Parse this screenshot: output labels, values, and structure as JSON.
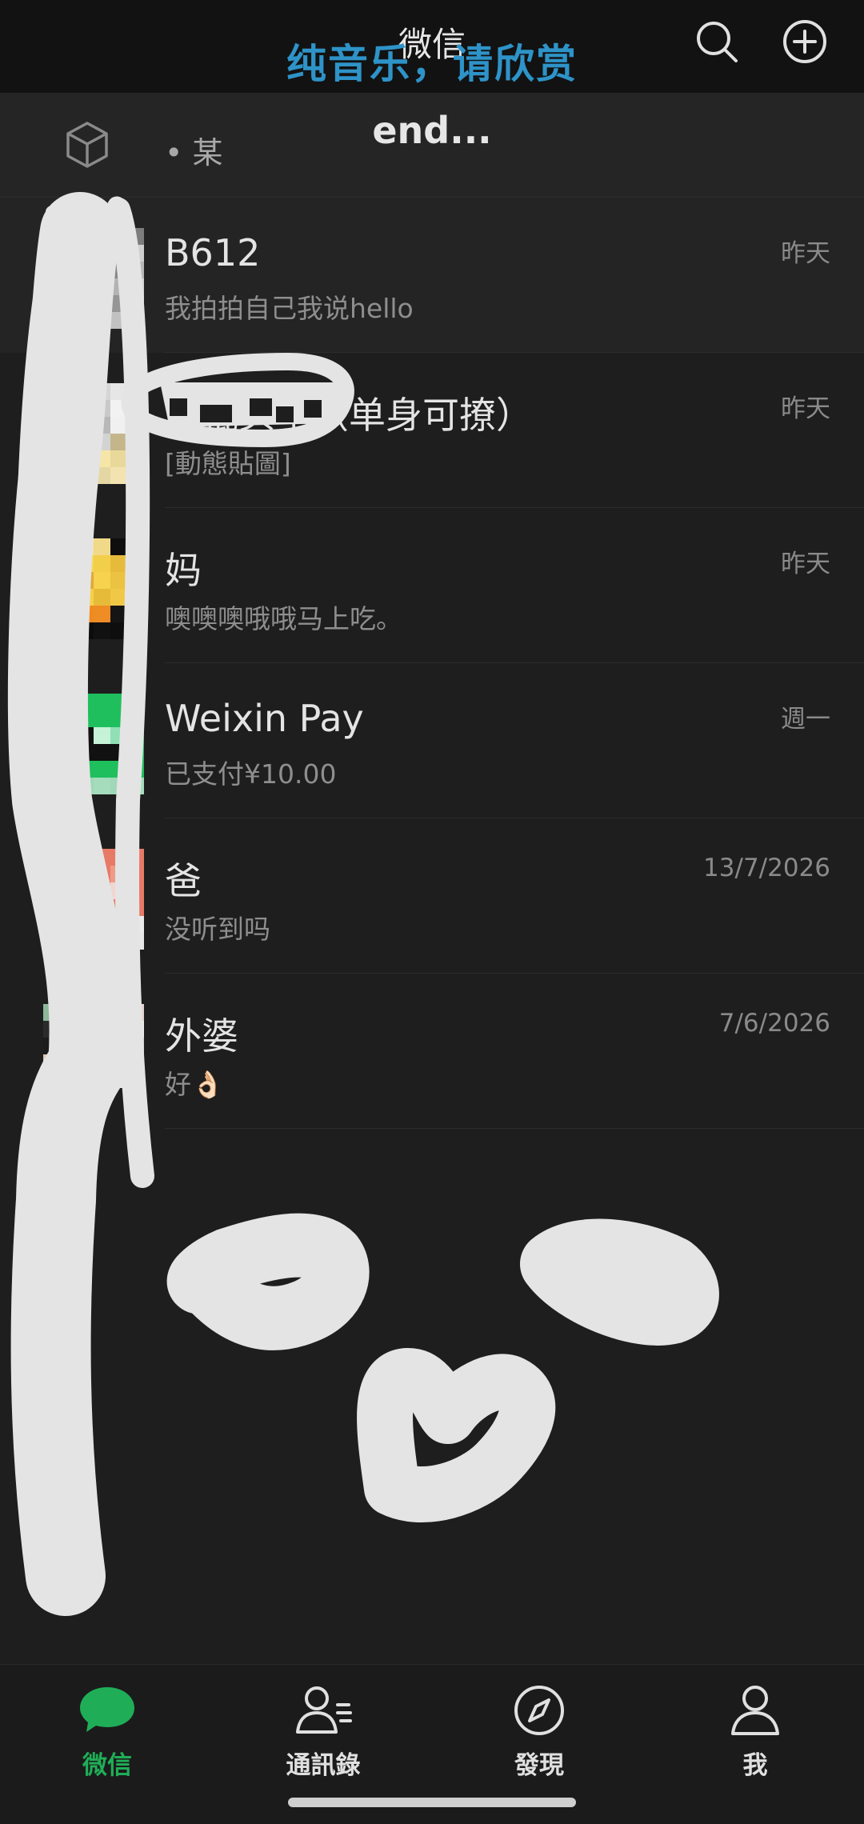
{
  "header": {
    "title": "微信",
    "overlay_caption": "纯音乐，请欣赏",
    "search_icon": "search-icon",
    "add_icon": "plus-circle-icon"
  },
  "subbar": {
    "icon": "cube-icon",
    "text": "• 某",
    "overlay_text": "end..."
  },
  "chats": [
    {
      "name": "B612",
      "preview": "我拍拍自己我说hello",
      "time": "昨天"
    },
    {
      "name": "恶棍头子（单身可撩）",
      "preview": "[動態貼圖]",
      "time": "昨天"
    },
    {
      "name": "妈",
      "preview": "噢噢噢哦哦马上吃。",
      "time": "昨天"
    },
    {
      "name": "Weixin Pay",
      "preview": "已支付¥10.00",
      "time": "週一"
    },
    {
      "name": "爸",
      "preview": "没听到吗",
      "time": "13/7/2026"
    },
    {
      "name": "外婆",
      "preview": "好👌🏻",
      "time": "7/6/2026"
    }
  ],
  "tabs": [
    {
      "label": "微信",
      "icon": "chat-bubble-icon",
      "active": true
    },
    {
      "label": "通訊錄",
      "icon": "contacts-icon",
      "active": false
    },
    {
      "label": "發現",
      "icon": "compass-icon",
      "active": false
    },
    {
      "label": "我",
      "icon": "person-icon",
      "active": false
    }
  ],
  "colors": {
    "accent": "#1fae57",
    "caption": "#2e93c8",
    "background": "#1e1e1e"
  }
}
